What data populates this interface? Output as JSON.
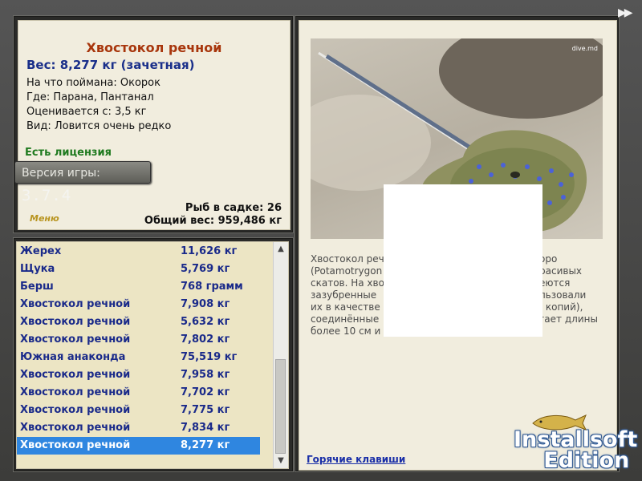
{
  "fish": {
    "title": "Хвостокол речной",
    "weight_line": "Вес: 8,277 кг (зачетная)",
    "details": [
      "На что поймана: Окорок",
      "Где: Парана, Пантанал",
      "Оценивается с: 3,5 кг",
      "Вид: Ловится очень редко"
    ]
  },
  "license": "Есть лицензия",
  "version": {
    "label": "Версия игры:",
    "number": "3.7.4"
  },
  "menu_label": "Меню",
  "stats": {
    "in_cage": "Рыб в садке: 26",
    "total_weight": "Общий вес: 959,486 кг"
  },
  "catch_list": [
    {
      "name": "Жерех",
      "weight": "11,626 кг"
    },
    {
      "name": "Щука",
      "weight": "5,769 кг"
    },
    {
      "name": "Берш",
      "weight": "768 грамм"
    },
    {
      "name": "Хвостокол речной",
      "weight": "7,908 кг"
    },
    {
      "name": "Хвостокол речной",
      "weight": "5,632 кг"
    },
    {
      "name": "Хвостокол речной",
      "weight": "7,802 кг"
    },
    {
      "name": "Южная анаконда",
      "weight": "75,519 кг"
    },
    {
      "name": "Хвостокол речной",
      "weight": "7,958 кг"
    },
    {
      "name": "Хвостокол речной",
      "weight": "7,702 кг"
    },
    {
      "name": "Хвостокол речной",
      "weight": "7,775 кг"
    },
    {
      "name": "Хвостокол речной",
      "weight": "7,834 кг"
    },
    {
      "name": "Хвостокол речной",
      "weight": "8,277 кг"
    }
  ],
  "selected_index": 11,
  "photo_credit": "dive.md",
  "description_lines": [
    "Хвостокол реч",
    "(Potamotrygon",
    "скатов. На хво",
    "зазубренные ",
    "их в качестве",
    "соединённые",
    "более 10 см и"
  ],
  "description_right": [
    "оро",
    "расивых",
    "еются",
    "льзовали",
    ": копий),",
    "гает длины",
    ""
  ],
  "hotkeys_label": "Горячие клавиши",
  "watermark": [
    "Installsoft",
    "Edition"
  ],
  "forward_icon": "fast-forward-icon",
  "colors": {
    "title": "#a8360c",
    "weight": "#1a2f8a",
    "license": "#1f7a1f",
    "list_text": "#1a2a8a",
    "selection": "#2f86e0"
  }
}
